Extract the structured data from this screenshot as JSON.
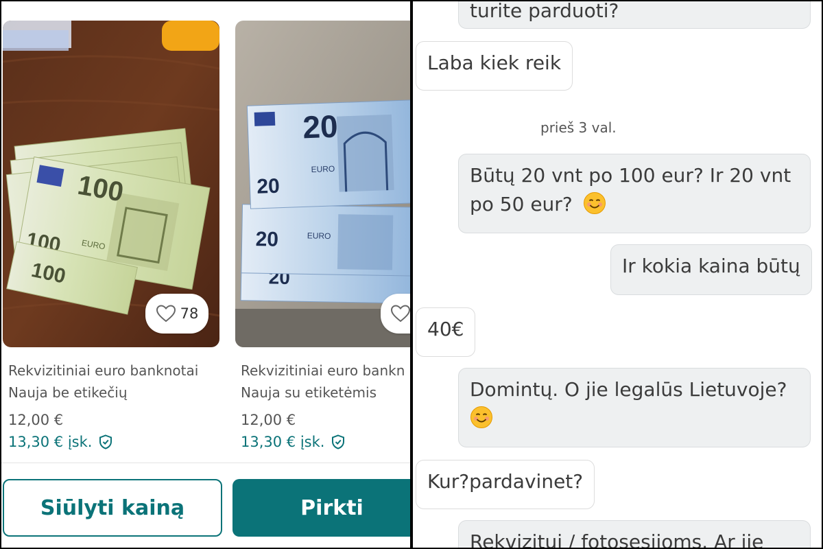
{
  "listings": [
    {
      "title": "Rekvizitiniai euro banknotai",
      "subtitle": "Nauja be etikečių",
      "price": "12,00 €",
      "price_incl": "13,30 € įsk.",
      "favorites": "78",
      "banknote_value": "100"
    },
    {
      "title": "Rekvizitiniai euro bankn",
      "subtitle": "Nauja su etiketėmis",
      "price": "12,00 €",
      "price_incl": "13,30 € įsk.",
      "favorites": "",
      "banknote_value": "20"
    }
  ],
  "actions": {
    "offer_label": "Siūlyti kainą",
    "buy_label": "Pirkti"
  },
  "chat": {
    "messages": [
      {
        "text": "turite parduoti?",
        "direction": "outgoing"
      },
      {
        "text": "Laba kiek reik",
        "direction": "incoming"
      },
      {
        "text_line1": "Būtų 20 vnt po 100 eur? Ir 20 vnt",
        "text_line2": "po 50 eur?",
        "emoji": "smiling-face",
        "direction": "outgoing"
      },
      {
        "text": "Ir kokia kaina būtų",
        "direction": "outgoing"
      },
      {
        "text": "40€",
        "direction": "incoming"
      },
      {
        "text_line1": "Domintų. O jie legalūs Lietuvoje?",
        "emoji": "smiling-face",
        "direction": "outgoing"
      },
      {
        "text": "Kur?pardavinet?",
        "direction": "incoming"
      },
      {
        "text": "Rekvizitui / fotosesijoms. Ar jie",
        "direction": "outgoing"
      }
    ],
    "timestamp": "prieš 3 val."
  },
  "colors": {
    "accent": "#0b7378",
    "outgoing_bubble": "#eef0f1"
  }
}
